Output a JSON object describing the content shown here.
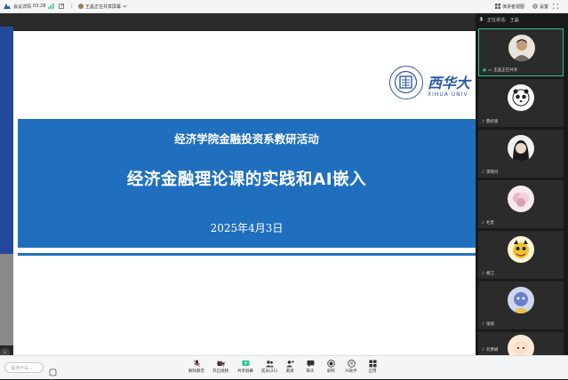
{
  "topbar": {
    "meeting_details": "会议详情",
    "time": "03:28",
    "sharing_status": "王晶正在共享屏幕",
    "speaker_view": "演讲者视图",
    "settings": "设置"
  },
  "slide": {
    "subtitle": "经济学院金融投资系教研活动",
    "title": "经济金融理论课的实践和AI嵌入",
    "date": "2025年4月3日",
    "logo_text": "西华大",
    "logo_sub": "XIHUA UNIV"
  },
  "panel": {
    "header_speaking": "正在讲话:",
    "header_speaker": "王晶",
    "participants": [
      {
        "name": "王晶正在共享",
        "active": true
      },
      {
        "name": "鼎好渡",
        "active": false
      },
      {
        "name": "李晓丹",
        "active": false
      },
      {
        "name": "毛晋",
        "active": false
      },
      {
        "name": "胡江",
        "active": false
      },
      {
        "name": "张丽",
        "active": false
      },
      {
        "name": "刘勇娟",
        "active": false
      }
    ]
  },
  "bottombar": {
    "chat_placeholder": "说点什么...",
    "buttons": [
      {
        "label": "解除静音",
        "icon": "microphone-icon"
      },
      {
        "label": "开启视频",
        "icon": "camera-icon"
      },
      {
        "label": "共享屏幕",
        "icon": "share-screen-icon"
      },
      {
        "label": "成员(21)",
        "icon": "members-icon"
      },
      {
        "label": "邀请",
        "icon": "invite-icon"
      },
      {
        "label": "聊天",
        "icon": "chat-icon"
      },
      {
        "label": "录制",
        "icon": "record-icon"
      },
      {
        "label": "AI助手",
        "icon": "ai-assistant-icon"
      },
      {
        "label": "应用",
        "icon": "apps-icon"
      }
    ]
  },
  "colors": {
    "banner": "#1f6fbe",
    "active_border": "#2bc48a",
    "logo": "#2a5aa8"
  }
}
